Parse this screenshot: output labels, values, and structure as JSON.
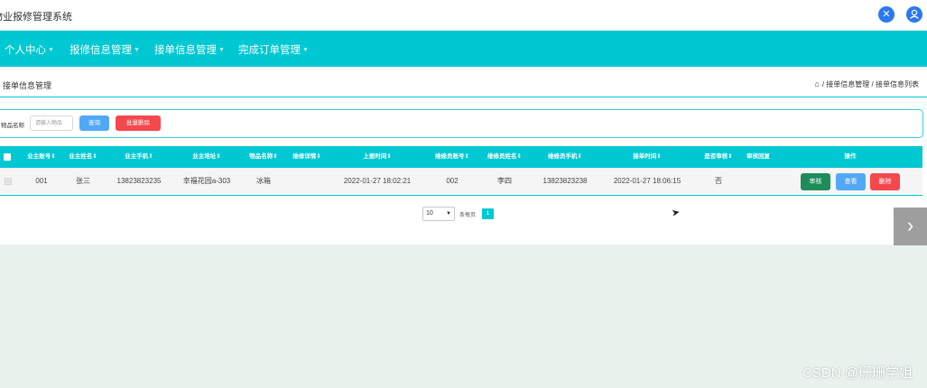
{
  "app": {
    "title": "物业报修管理系统"
  },
  "topbar": {
    "expand_icon": "expand-icon",
    "user_icon": "user-icon"
  },
  "nav": {
    "items": [
      {
        "label": "个人中心"
      },
      {
        "label": "报修信息管理"
      },
      {
        "label": "接单信息管理"
      },
      {
        "label": "完成订单管理"
      }
    ]
  },
  "page": {
    "title": "接单信息管理",
    "breadcrumb": {
      "level1": "接单信息管理",
      "level2": "接单信息列表",
      "separator": "/"
    }
  },
  "search": {
    "label": "物品名称",
    "placeholder": "请输入物品",
    "value": "",
    "query_label": "查询",
    "batch_delete_label": "批量删除"
  },
  "table": {
    "columns": [
      "业主账号",
      "业主姓名",
      "业主手机",
      "业主地址",
      "物品名称",
      "维修详情",
      "上报时间",
      "维修员账号",
      "维修员姓名",
      "维修员手机",
      "接单时间",
      "是否审核",
      "审核回复",
      "操作"
    ],
    "rows": [
      {
        "owner_account": "001",
        "owner_name": "张三",
        "owner_phone": "13823823235",
        "owner_address": "幸福花园a-303",
        "item_name": "冰箱",
        "repair_detail": "",
        "report_time": "2022-01-27 18:02:21",
        "repairer_account": "002",
        "repairer_name": "李四",
        "repairer_phone": "13823823238",
        "accept_time": "2022-01-27 18:06:15",
        "is_reviewed": "否",
        "review_reply": "",
        "actions": {
          "review": "审核",
          "view": "查看",
          "delete": "删除"
        }
      }
    ]
  },
  "pagination": {
    "page_size": "10",
    "per_page_label": "条每页",
    "current_page": "1"
  },
  "watermark": "CSDN @珊珊学姐",
  "colors": {
    "accent": "#00c8d2",
    "primary": "#52a8f6",
    "danger": "#f4484d",
    "success": "#1e8c5a"
  }
}
